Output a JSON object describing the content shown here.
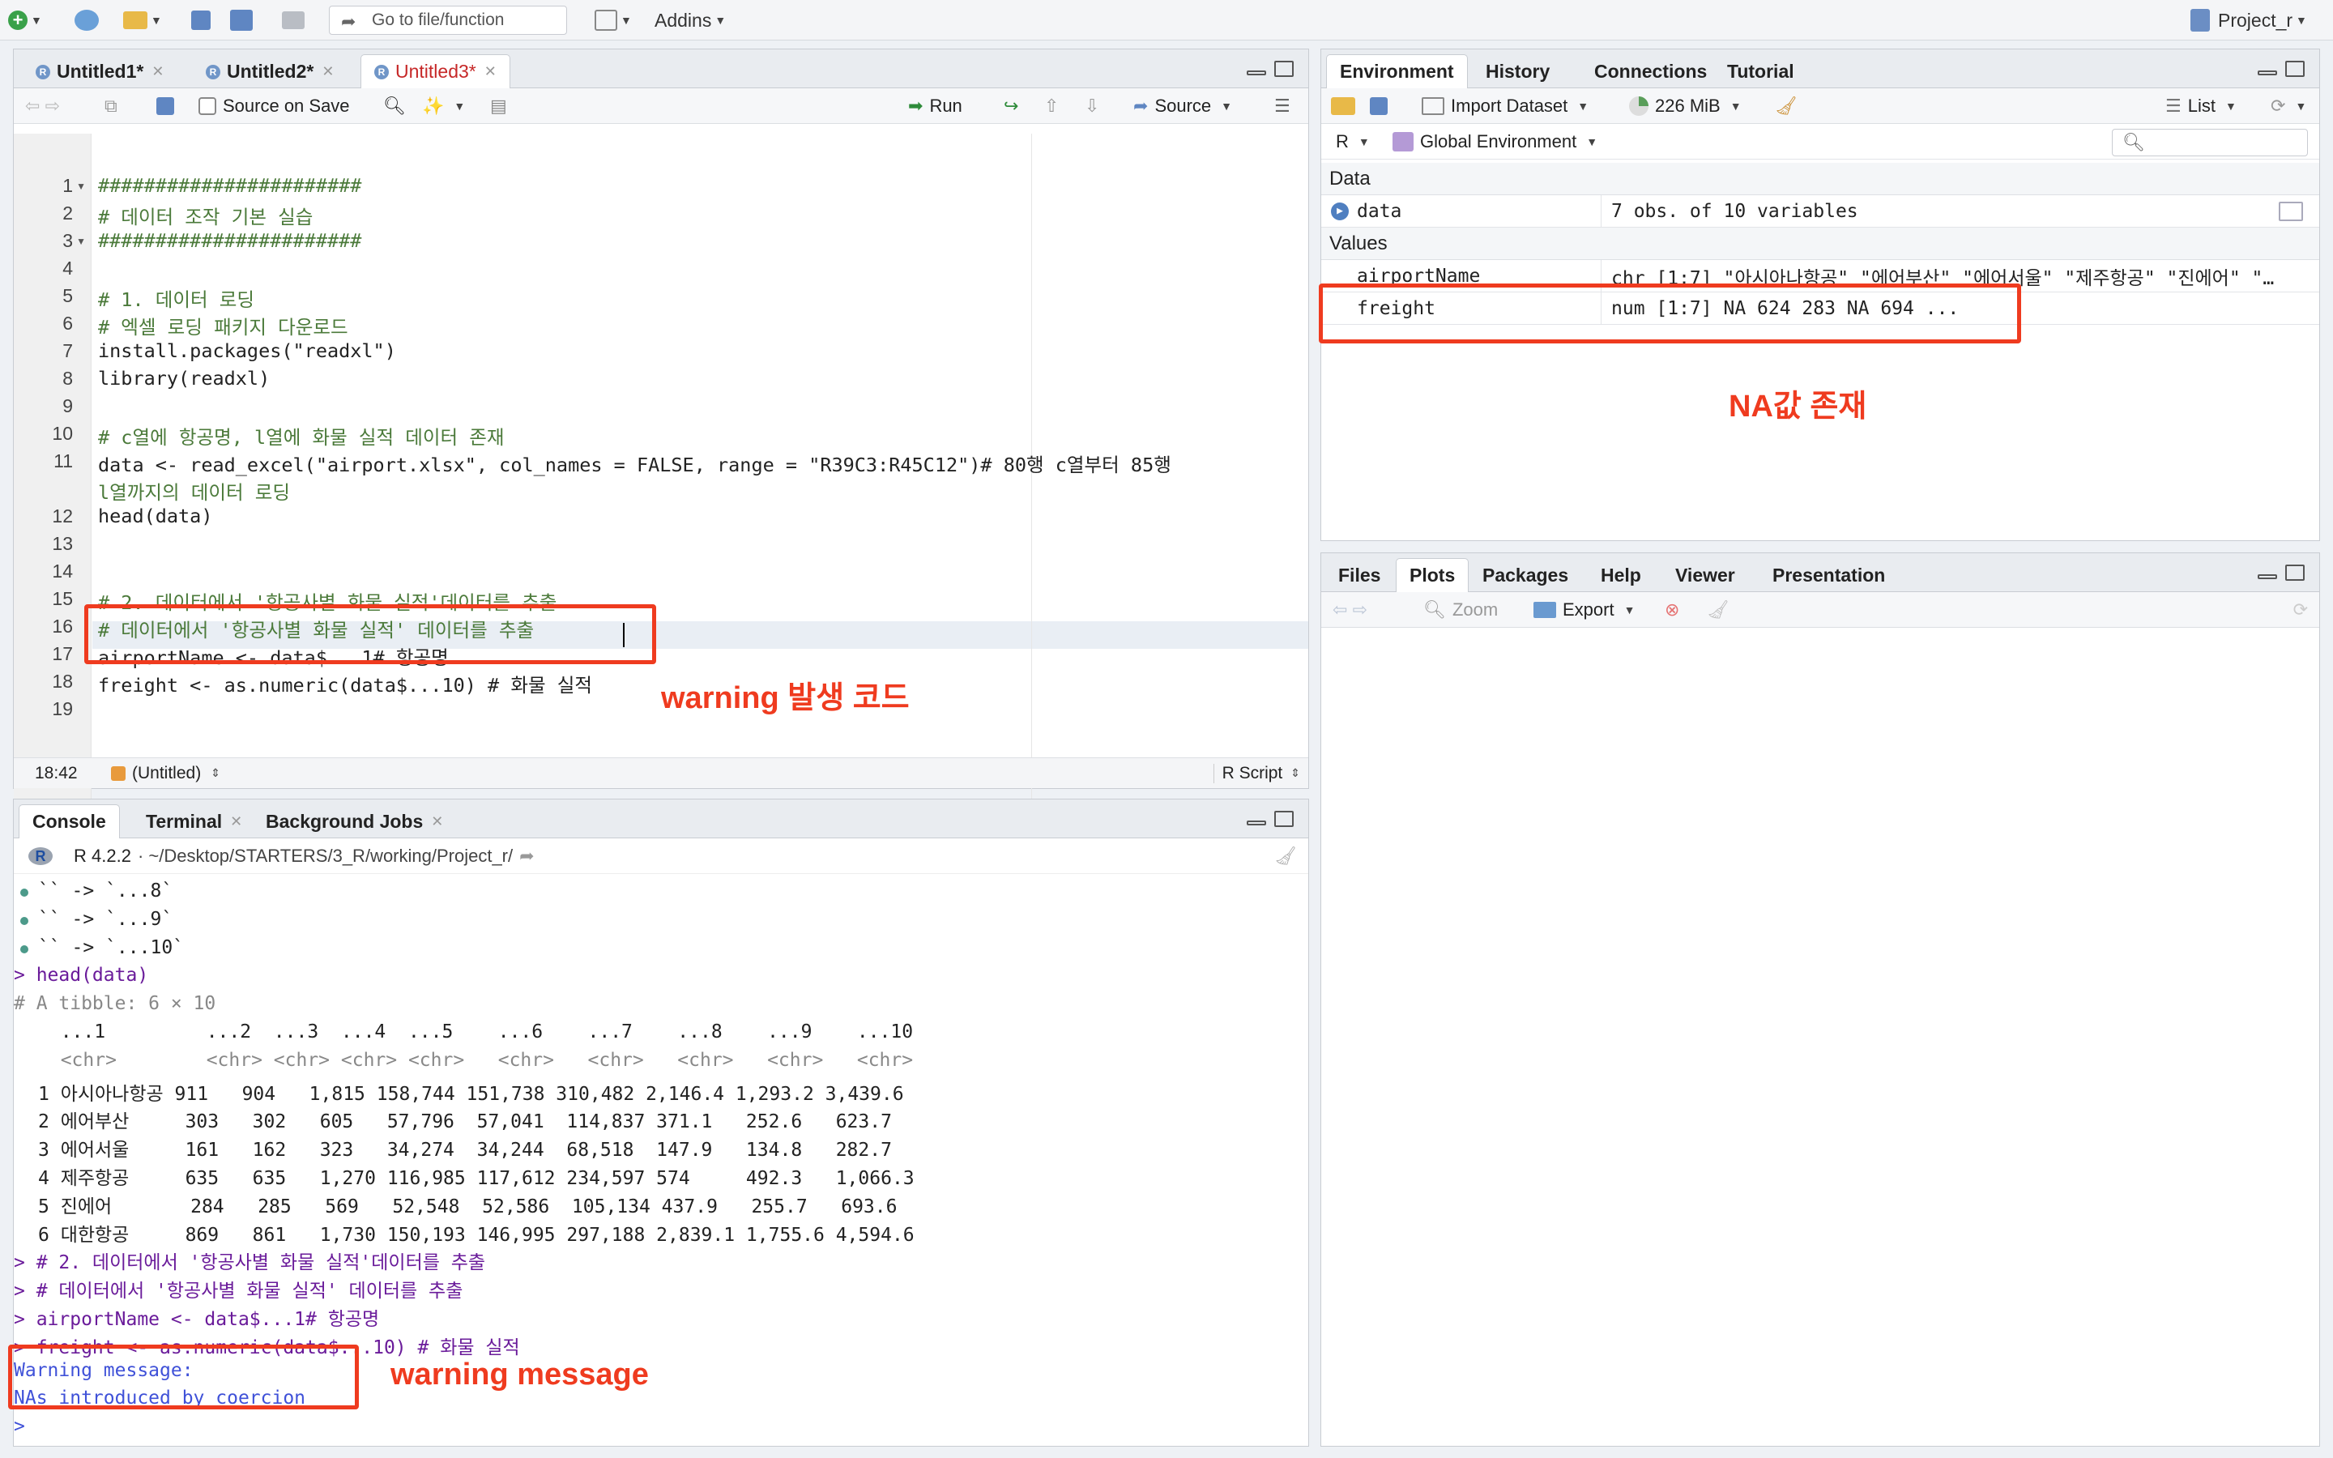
{
  "toolbar": {
    "goto_placeholder": "Go to file/function",
    "addins": "Addins",
    "project": "Project_r"
  },
  "editor": {
    "tabs": [
      "Untitled1*",
      "Untitled2*",
      "Untitled3*"
    ],
    "source_on_save": "Source on Save",
    "run": "Run",
    "source": "Source",
    "lines": [
      "#######################",
      "# 데이터 조작 기본 실습",
      "#######################",
      "",
      "# 1. 데이터 로딩",
      "# 엑셀 로딩 패키지 다운로드",
      "install.packages(\"readxl\")",
      "library(readxl)",
      "",
      "# c열에 항공명, l열에 화물 실적 데이터 존재",
      "data <- read_excel(\"airport.xlsx\", col_names = FALSE, range = \"R39C3:R45C12\")# 80행 c열부터 85행",
      "l열까지의 데이터 로딩",
      "head(data)",
      "",
      "",
      "# 2. 데이터에서 '항공사별 화물 실적'데이터를 추출",
      "# 데이터에서 '항공사별 화물 실적' 데이터를 추출",
      "airportName <- data$...1# 항공명",
      "freight <- as.numeric(data$...10) # 화물 실적"
    ],
    "status_pos": "18:42",
    "status_scope": "(Untitled)",
    "status_type": "R Script"
  },
  "env": {
    "tabs": [
      "Environment",
      "History",
      "Connections",
      "Tutorial"
    ],
    "import_dataset": "Import Dataset",
    "memory": "226 MiB",
    "list_label": "List",
    "lang": "R",
    "scope": "Global Environment",
    "data_header": "Data",
    "values_header": "Values",
    "data_row": {
      "name": "data",
      "value": "7 obs. of 10 variables"
    },
    "values": [
      {
        "name": "airportName",
        "value": "chr [1:7] \"아시아나항공\" \"에어부산\" \"에어서울\" \"제주항공\" \"진에어\" \"…"
      },
      {
        "name": "freight",
        "value": "num [1:7] NA 624 283 NA 694 ..."
      }
    ]
  },
  "files": {
    "tabs": [
      "Files",
      "Plots",
      "Packages",
      "Help",
      "Viewer",
      "Presentation"
    ],
    "zoom": "Zoom",
    "export": "Export"
  },
  "console": {
    "tabs": [
      "Console",
      "Terminal",
      "Background Jobs"
    ],
    "path_r": "R 4.2.2",
    "path": "· ~/Desktop/STARTERS/3_R/working/Project_r/",
    "lines": [
      {
        "t": "`` -> `...8`",
        "c": "dot"
      },
      {
        "t": "`` -> `...9`",
        "c": "dot"
      },
      {
        "t": "`` -> `...10`",
        "c": "dot"
      },
      {
        "t": "> head(data)",
        "c": "cin"
      },
      {
        "t": "# A tibble: 6 × 10",
        "c": "gray"
      },
      {
        "t": "  ...1         ...2  ...3  ...4  ...5    ...6    ...7    ...8    ...9    ...10",
        "c": ""
      },
      {
        "t": "  <chr>        <chr> <chr> <chr> <chr>   <chr>   <chr>   <chr>   <chr>   <chr>",
        "c": "gray"
      },
      {
        "t": "1 아시아나항공 911   904   1,815 158,744 151,738 310,482 2,146.4 1,293.2 3,439.6",
        "c": ""
      },
      {
        "t": "2 에어부산     303   302   605   57,796  57,041  114,837 371.1   252.6   623.7",
        "c": ""
      },
      {
        "t": "3 에어서울     161   162   323   34,274  34,244  68,518  147.9   134.8   282.7",
        "c": ""
      },
      {
        "t": "4 제주항공     635   635   1,270 116,985 117,612 234,597 574     492.3   1,066.3",
        "c": ""
      },
      {
        "t": "5 진에어       284   285   569   52,548  52,586  105,134 437.9   255.7   693.6",
        "c": ""
      },
      {
        "t": "6 대한항공     869   861   1,730 150,193 146,995 297,188 2,839.1 1,755.6 4,594.6",
        "c": ""
      },
      {
        "t": "> # 2. 데이터에서 '항공사별 화물 실적'데이터를 추출",
        "c": "cin"
      },
      {
        "t": "> # 데이터에서 '항공사별 화물 실적' 데이터를 추출",
        "c": "cin"
      },
      {
        "t": "> airportName <- data$...1# 항공명",
        "c": "cin"
      },
      {
        "t": "> freight <- as.numeric(data$...10) # 화물 실적",
        "c": "cin"
      },
      {
        "t": "Warning message:",
        "c": "blue"
      },
      {
        "t": "NAs introduced by coercion",
        "c": "blue"
      },
      {
        "t": "> ",
        "c": "blue"
      }
    ]
  },
  "annotations": {
    "code": "warning 발생 코드",
    "na": "NA값 존재",
    "msg": "warning message"
  }
}
